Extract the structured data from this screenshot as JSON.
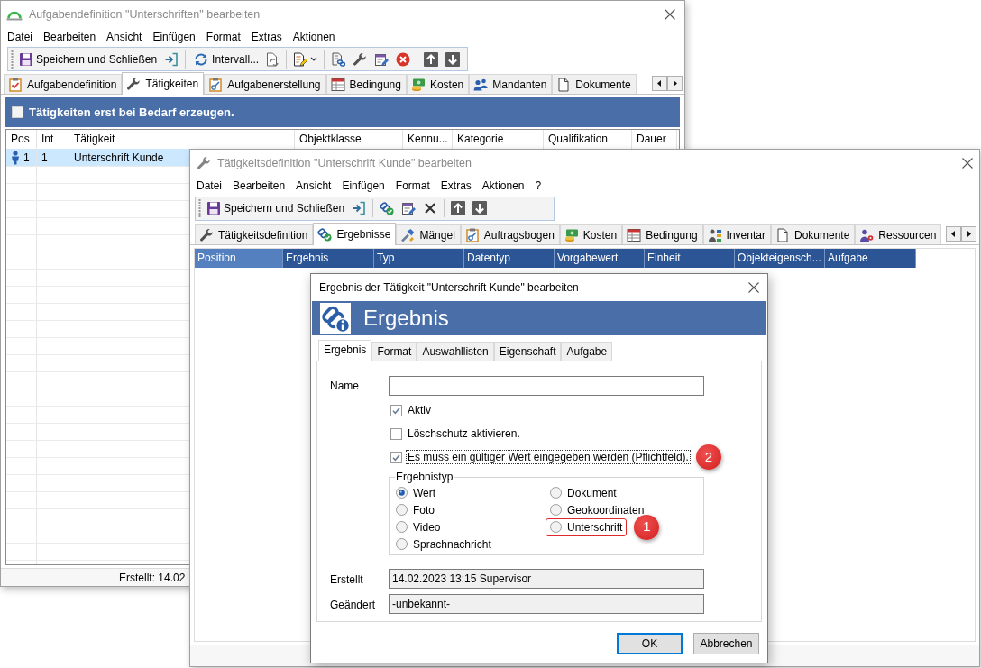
{
  "task_window": {
    "title": "Aufgabendefinition \"Unterschriften\" bearbeiten",
    "menu": [
      "Datei",
      "Bearbeiten",
      "Ansicht",
      "Einfügen",
      "Format",
      "Extras",
      "Aktionen"
    ],
    "toolbar": {
      "save_button": "Speichern und Schließen",
      "interval_button": "Intervall..."
    },
    "tabs": [
      {
        "label": "Aufgabendefinition",
        "selected": false
      },
      {
        "label": "Tätigkeiten",
        "selected": true
      },
      {
        "label": "Aufgabenerstellung",
        "selected": false
      },
      {
        "label": "Bedingung",
        "selected": false
      },
      {
        "label": "Kosten",
        "selected": false
      },
      {
        "label": "Mandanten",
        "selected": false
      },
      {
        "label": "Dokumente",
        "selected": false
      }
    ],
    "banner": {
      "label": "Tätigkeiten erst bei Bedarf erzeugen.",
      "checked": false
    },
    "table": {
      "columns": [
        "Pos",
        "Int",
        "Tätigkeit",
        "Objektklasse",
        "Kennu...",
        "Kategorie",
        "Qualifikation",
        "Dauer"
      ],
      "rows": [
        {
          "selected": true,
          "cells": [
            "1",
            "1",
            "Unterschrift Kunde"
          ]
        }
      ]
    },
    "status_bar": "Erstellt: 14.02"
  },
  "activity_window": {
    "title": "Tätigkeitsdefinition \"Unterschrift Kunde\" bearbeiten",
    "menu": [
      "Datei",
      "Bearbeiten",
      "Ansicht",
      "Einfügen",
      "Format",
      "Extras",
      "Aktionen",
      "?"
    ],
    "toolbar": {
      "save_button": "Speichern und Schließen"
    },
    "tabs": [
      {
        "label": "Tätigkeitsdefinition",
        "selected": false
      },
      {
        "label": "Ergebnisse",
        "selected": true
      },
      {
        "label": "Mängel",
        "selected": false
      },
      {
        "label": "Auftragsbogen",
        "selected": false
      },
      {
        "label": "Kosten",
        "selected": false
      },
      {
        "label": "Bedingung",
        "selected": false
      },
      {
        "label": "Inventar",
        "selected": false
      },
      {
        "label": "Dokumente",
        "selected": false
      },
      {
        "label": "Ressourcen",
        "selected": false
      }
    ],
    "table": {
      "columns": [
        {
          "label": "Position",
          "highlighted": true
        },
        {
          "label": "Ergebnis",
          "highlighted": false
        },
        {
          "label": "Typ",
          "highlighted": false
        },
        {
          "label": "Datentyp",
          "highlighted": false
        },
        {
          "label": "Vorgabewert",
          "highlighted": false
        },
        {
          "label": "Einheit",
          "highlighted": false
        },
        {
          "label": "Objekteigensch...",
          "highlighted": false
        },
        {
          "label": "Aufgabe",
          "highlighted": false
        }
      ]
    }
  },
  "result_dialog": {
    "title": "Ergebnis der Tätigkeit \"Unterschrift Kunde\" bearbeiten",
    "header": "Ergebnis",
    "tabs": [
      {
        "label": "Ergebnis",
        "selected": true
      },
      {
        "label": "Format",
        "selected": false
      },
      {
        "label": "Auswahllisten",
        "selected": false
      },
      {
        "label": "Eigenschaft",
        "selected": false
      },
      {
        "label": "Aufgabe",
        "selected": false
      }
    ],
    "name_field": {
      "label": "Name"
    },
    "checkboxes": [
      {
        "label": "Aktiv",
        "checked": true,
        "focused": false
      },
      {
        "label": "Löschschutz aktivieren.",
        "checked": false,
        "focused": false
      },
      {
        "label": "Es muss ein gültiger Wert eingegeben werden (Pflichtfeld).",
        "checked": true,
        "focused": true,
        "callout": "2"
      }
    ],
    "result_type": {
      "label": "Ergebnistyp",
      "options": [
        {
          "label": "Wert",
          "selected": true,
          "highlighted": false
        },
        {
          "label": "Foto",
          "selected": false,
          "highlighted": false
        },
        {
          "label": "Video",
          "selected": false,
          "highlighted": false
        },
        {
          "label": "Sprachnachricht",
          "selected": false,
          "highlighted": false
        },
        {
          "label": "Dokument",
          "selected": false,
          "highlighted": false
        },
        {
          "label": "Geokoordinaten",
          "selected": false,
          "highlighted": false
        },
        {
          "label": "Unterschrift",
          "selected": false,
          "highlighted": true,
          "callout": "1"
        }
      ]
    },
    "created": {
      "label": "Erstellt",
      "value": "14.02.2023 13:15 Supervisor"
    },
    "changed": {
      "label": "Geändert",
      "value": "-unbekannt-"
    },
    "buttons": [
      {
        "label": "OK",
        "default": true
      },
      {
        "label": "Abbrechen",
        "default": false
      }
    ]
  }
}
